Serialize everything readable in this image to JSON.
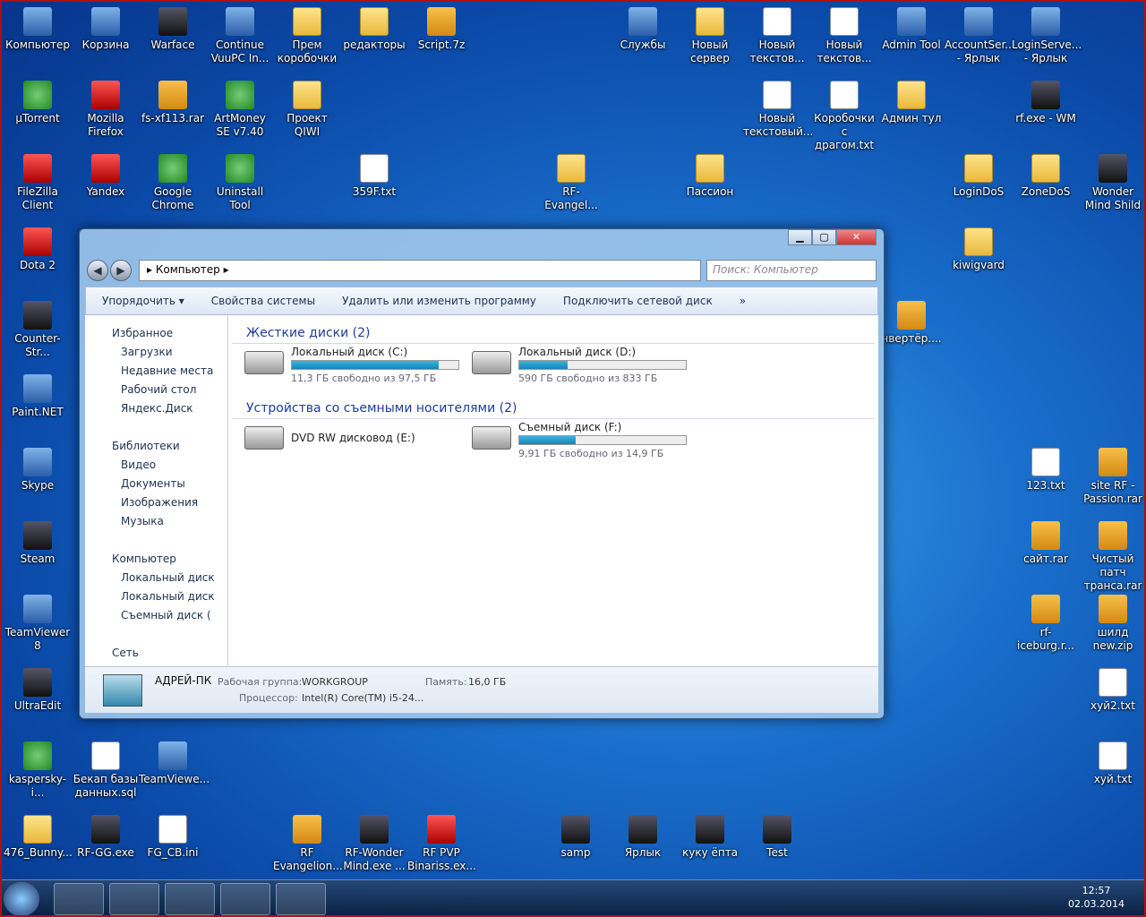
{
  "desktop_icons": [
    [
      "Компьютер",
      "app",
      4,
      8
    ],
    [
      "Корзина",
      "app",
      80,
      8
    ],
    [
      "Warface",
      "drk",
      155,
      8
    ],
    [
      "Continue VuuPC In...",
      "app",
      230,
      8
    ],
    [
      "Прем коробочки",
      "fold",
      305,
      8
    ],
    [
      "редакторы",
      "fold",
      380,
      8
    ],
    [
      "Script.7z",
      "rar",
      455,
      8
    ],
    [
      "Службы",
      "app",
      680,
      8
    ],
    [
      "Новый сервер",
      "fold",
      755,
      8
    ],
    [
      "Новый текстов...",
      "doc",
      830,
      8
    ],
    [
      "Новый текстов...",
      "doc",
      905,
      8
    ],
    [
      "Admin Tool",
      "app",
      980,
      8
    ],
    [
      "AccountSer... - Ярлык",
      "app",
      1055,
      8
    ],
    [
      "LoginServe... - Ярлык",
      "app",
      1130,
      8
    ],
    [
      "µTorrent",
      "grn",
      4,
      90
    ],
    [
      "Mozilla Firefox",
      "red",
      80,
      90
    ],
    [
      "fs-xf113.rar",
      "rar",
      155,
      90
    ],
    [
      "ArtMoney SE v7.40",
      "grn",
      230,
      90
    ],
    [
      "Проект QIWI",
      "fold",
      305,
      90
    ],
    [
      "Новый текстовый...",
      "doc",
      830,
      90
    ],
    [
      "Коробочки с драгом.txt",
      "doc",
      905,
      90
    ],
    [
      "Админ тул",
      "fold",
      980,
      90
    ],
    [
      "rf.exe - WM",
      "drk",
      1130,
      90
    ],
    [
      "FileZilla Client",
      "red",
      4,
      172
    ],
    [
      "Yandex",
      "red",
      80,
      172
    ],
    [
      "Google Chrome",
      "grn",
      155,
      172
    ],
    [
      "Uninstall Tool",
      "grn",
      230,
      172
    ],
    [
      "359F.txt",
      "doc",
      380,
      172
    ],
    [
      "RF-Evangel...",
      "fold",
      600,
      172
    ],
    [
      "Пассион",
      "fold",
      755,
      172
    ],
    [
      "LoginDoS",
      "fold",
      1055,
      172
    ],
    [
      "ZoneDoS",
      "fold",
      1130,
      172
    ],
    [
      "Wonder Mind Shild",
      "drk",
      1205,
      172
    ],
    [
      "Dota 2",
      "red",
      4,
      254
    ],
    [
      "kiwigvard",
      "fold",
      1055,
      254
    ],
    [
      "Counter-Str...",
      "drk",
      4,
      336
    ],
    [
      "нвертёр....",
      "rar",
      980,
      336
    ],
    [
      "Paint.NET",
      "app",
      4,
      418
    ],
    [
      "Skype",
      "app",
      4,
      500
    ],
    [
      "123.txt",
      "doc",
      1130,
      500
    ],
    [
      "site RF - Passion.rar",
      "rar",
      1205,
      500
    ],
    [
      "Steam",
      "drk",
      4,
      582
    ],
    [
      "сайт.rar",
      "rar",
      1130,
      582
    ],
    [
      "Чистый патч транса.rar",
      "rar",
      1205,
      582
    ],
    [
      "TeamViewer 8",
      "app",
      4,
      664
    ],
    [
      "rf-iceburg.r...",
      "rar",
      1130,
      664
    ],
    [
      "шилд new.zip",
      "rar",
      1205,
      664
    ],
    [
      "UltraEdit",
      "drk",
      4,
      746
    ],
    [
      "хуй2.txt",
      "doc",
      1205,
      746
    ],
    [
      "kaspersky-i...",
      "grn",
      4,
      828
    ],
    [
      "Бекап базы данных.sql",
      "doc",
      80,
      828
    ],
    [
      "TeamViewe...",
      "app",
      155,
      828
    ],
    [
      "хуй.txt",
      "doc",
      1205,
      828
    ],
    [
      "476_Bunny...",
      "fold",
      4,
      910
    ],
    [
      "RF-GG.exe",
      "drk",
      80,
      910
    ],
    [
      "FG_CB.ini",
      "doc",
      155,
      910
    ],
    [
      "RF Evangelion...",
      "rar",
      305,
      910
    ],
    [
      "RF-Wonder Mind.exe ...",
      "drk",
      380,
      910
    ],
    [
      "RF PVP Binariss.ex...",
      "red",
      455,
      910
    ],
    [
      "samp",
      "drk",
      605,
      910
    ],
    [
      "Ярлык",
      "drk",
      680,
      910
    ],
    [
      "куку ёпта",
      "drk",
      755,
      910
    ],
    [
      "Test",
      "drk",
      830,
      910
    ]
  ],
  "explorer": {
    "path": "Компьютер",
    "search": "Поиск: Компьютер",
    "toolbar": [
      "Упорядочить ▾",
      "Свойства системы",
      "Удалить или изменить программу",
      "Подключить сетевой диск",
      "»"
    ],
    "sidebar": [
      [
        "Избранное",
        0
      ],
      [
        "Загрузки",
        1
      ],
      [
        "Недавние места",
        1
      ],
      [
        "Рабочий стол",
        1
      ],
      [
        "Яндекс.Диск",
        1
      ],
      [
        "",
        0
      ],
      [
        "Библиотеки",
        0
      ],
      [
        "Видео",
        1
      ],
      [
        "Документы",
        1
      ],
      [
        "Изображения",
        1
      ],
      [
        "Музыка",
        1
      ],
      [
        "",
        0
      ],
      [
        "Компьютер",
        0
      ],
      [
        "Локальный диск",
        1
      ],
      [
        "Локальный диск",
        1
      ],
      [
        "Съемный диск (",
        1
      ],
      [
        "",
        0
      ],
      [
        "Сеть",
        0
      ]
    ],
    "group_hdd": "Жесткие диски (2)",
    "group_rem": "Устройства со съемными носителями (2)",
    "drives": [
      {
        "name": "Локальный диск (C:)",
        "free": "11,3 ГБ свободно из 97,5 ГБ",
        "used": 0.88
      },
      {
        "name": "Локальный диск (D:)",
        "free": "590 ГБ свободно из 833 ГБ",
        "used": 0.29
      },
      {
        "name": "DVD RW дисковод (E:)",
        "free": "",
        "used": null
      },
      {
        "name": "Съемный диск (F:)",
        "free": "9,91 ГБ свободно из 14,9 ГБ",
        "used": 0.34
      }
    ],
    "details": {
      "pc": "АДРЕЙ-ПК",
      "wg_label": "Рабочая группа:",
      "wg": "WORKGROUP",
      "mem_label": "Память:",
      "mem": "16,0 ГБ",
      "cpu_label": "Процессор:",
      "cpu": "Intel(R) Core(TM) i5-24..."
    }
  },
  "clock": {
    "time": "12:57",
    "date": "02.03.2014"
  }
}
